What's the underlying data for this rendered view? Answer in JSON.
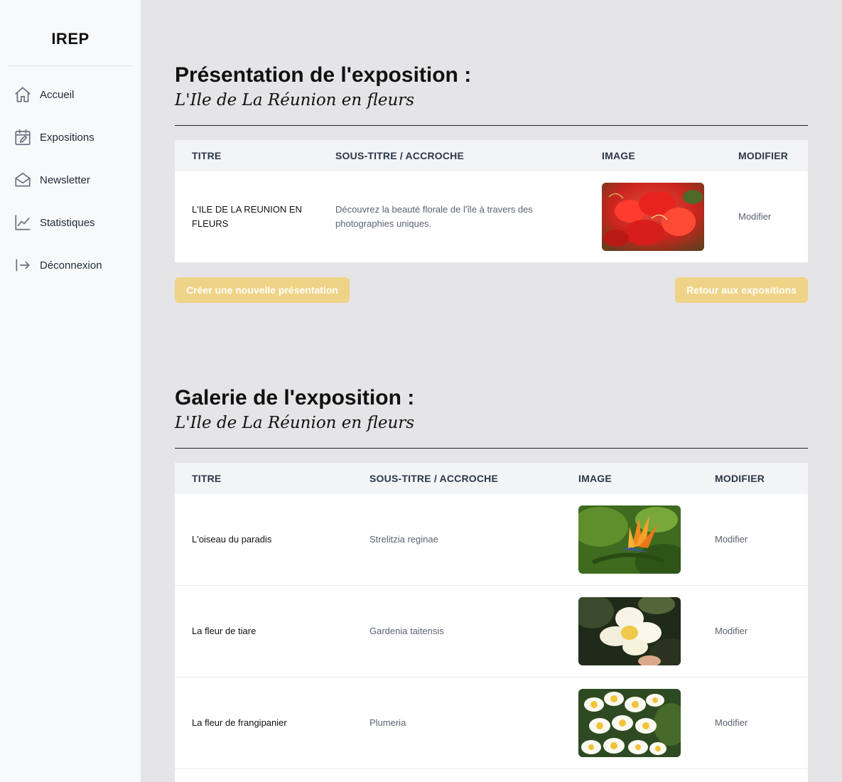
{
  "sidebar": {
    "brand": "IREP",
    "items": [
      {
        "label": "Accueil",
        "icon": "home-icon"
      },
      {
        "label": "Expositions",
        "icon": "calendar-edit-icon"
      },
      {
        "label": "Newsletter",
        "icon": "envelope-open-icon"
      },
      {
        "label": "Statistiques",
        "icon": "line-chart-icon"
      },
      {
        "label": "Déconnexion",
        "icon": "logout-icon"
      }
    ]
  },
  "presentation": {
    "title": "Présentation de l'exposition :",
    "subtitle": "L'Ile de La Réunion en fleurs",
    "headers": {
      "title": "Titre",
      "subtitle": "Sous-titre / Accroche",
      "image": "Image",
      "edit": "Modifier"
    },
    "rows": [
      {
        "title": "L'ILE DE LA REUNION EN FLEURS",
        "subtitle": "Découvrez la beauté florale de l'île à travers des photographies uniques.",
        "edit": "Modifier"
      }
    ],
    "create_button": "Créer une nouvelle présentation",
    "back_button": "Retour aux expositions"
  },
  "gallery": {
    "title": "Galerie de l'exposition :",
    "subtitle": "L'Ile de La Réunion en fleurs",
    "headers": {
      "title": "Titre",
      "subtitle": "Sous-titre / Accroche",
      "image": "Image",
      "edit": "Modifier"
    },
    "rows": [
      {
        "title": "L'oiseau du paradis",
        "subtitle": "Strelitzia reginae",
        "edit": "Modifier"
      },
      {
        "title": "La fleur de tiare",
        "subtitle": "Gardenia taitensis",
        "edit": "Modifier"
      },
      {
        "title": "La fleur de frangipanier",
        "subtitle": "Plumeria",
        "edit": "Modifier"
      },
      {
        "title": "",
        "subtitle": "",
        "edit": ""
      }
    ]
  },
  "colors": {
    "accent_button": "#efd386",
    "background": "#e5e5e7",
    "sidebar": "#f8f9fb"
  }
}
